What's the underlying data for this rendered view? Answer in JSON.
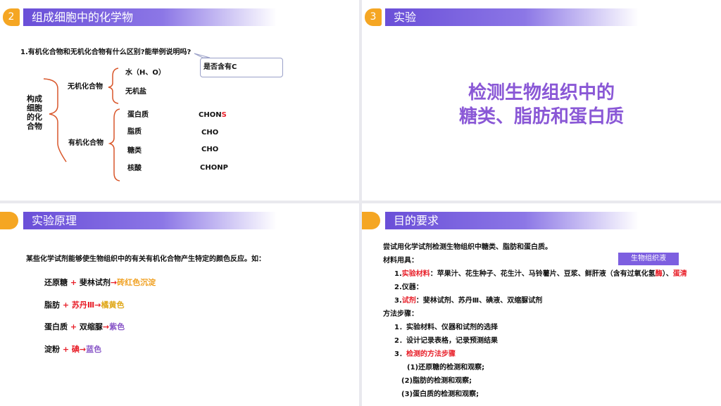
{
  "slide1": {
    "badge": "2",
    "title": "组成细胞中的化学物",
    "question": "1.有机化合物和无机化合物有什么区别?能举例说明吗?",
    "callout": "是否含有C",
    "root_label": [
      "构成",
      "细胞",
      "的化",
      "合物"
    ],
    "inorganic": "无机化合物",
    "water": "水（H、O）",
    "salt": "无机盐",
    "organic": "有机化合物",
    "items": [
      {
        "name": "蛋白质",
        "formula": "CHON",
        "formula_extra": "S"
      },
      {
        "name": "脂质",
        "formula": "CHO",
        "formula_extra": ""
      },
      {
        "name": "糖类",
        "formula": "CHO",
        "formula_extra": ""
      },
      {
        "name": "核酸",
        "formula": "CHONP",
        "formula_extra": ""
      }
    ]
  },
  "slide2": {
    "badge": "3",
    "title": "实验",
    "heading_line1": "检测生物组织中的",
    "heading_line2": "糖类、脂肪和蛋白质"
  },
  "slide3": {
    "title": "实验原理",
    "intro": "某些化学试剂能够使生物组织中的有关有机化合物产生特定的颜色反应。如：",
    "reactions": [
      {
        "a": "还原糖",
        "plus": " + ",
        "b": "斐林试剂",
        "arrow": "→",
        "c": "砖红色沉淀"
      },
      {
        "a": "脂肪",
        "plus": " + ",
        "b": "苏丹Ⅲ",
        "arrow": "→",
        "c": "橘黄色"
      },
      {
        "a": "蛋白质",
        "plus": " + ",
        "b": "双缩脲",
        "arrow": "→",
        "c": "紫色"
      },
      {
        "a": "淀粉",
        "plus": " + ",
        "b": "碘",
        "arrow": "→",
        "c": "蓝色"
      }
    ]
  },
  "slide4": {
    "title": "目的要求",
    "purpose": "尝试用化学试剂检测生物组织中糖类、脂肪和蛋白质。",
    "materials_label": "材料用具：",
    "tag": "生物组织液",
    "m1_num": "1.",
    "m1_label": "实验材料",
    "m1_text": "：苹果汁、花生种子、花生汁、马铃薯片、豆浆、鲜肝液（含有过氧化氢",
    "m1_red_char": "酶",
    "m1_tail": "）、",
    "m1_egg": "蛋清",
    "m2": "2.仪器：",
    "m3_num": "3.",
    "m3_label": "试剂",
    "m3_text": "：斐林试剂、苏丹Ⅲ、碘液、双缩脲试剂",
    "steps_label": "方法步骤：",
    "s1": "1．实验材料、仪器和试剂的选择",
    "s2": "2．设计记录表格，记录预测结果",
    "s3_num": "3．",
    "s3_text": "检测的方法步骤",
    "sub1": "(1)还原糖的检测和观察;",
    "sub2": "(2)脂肪的检测和观察;",
    "sub3": "(3)蛋白质的检测和观察;"
  }
}
